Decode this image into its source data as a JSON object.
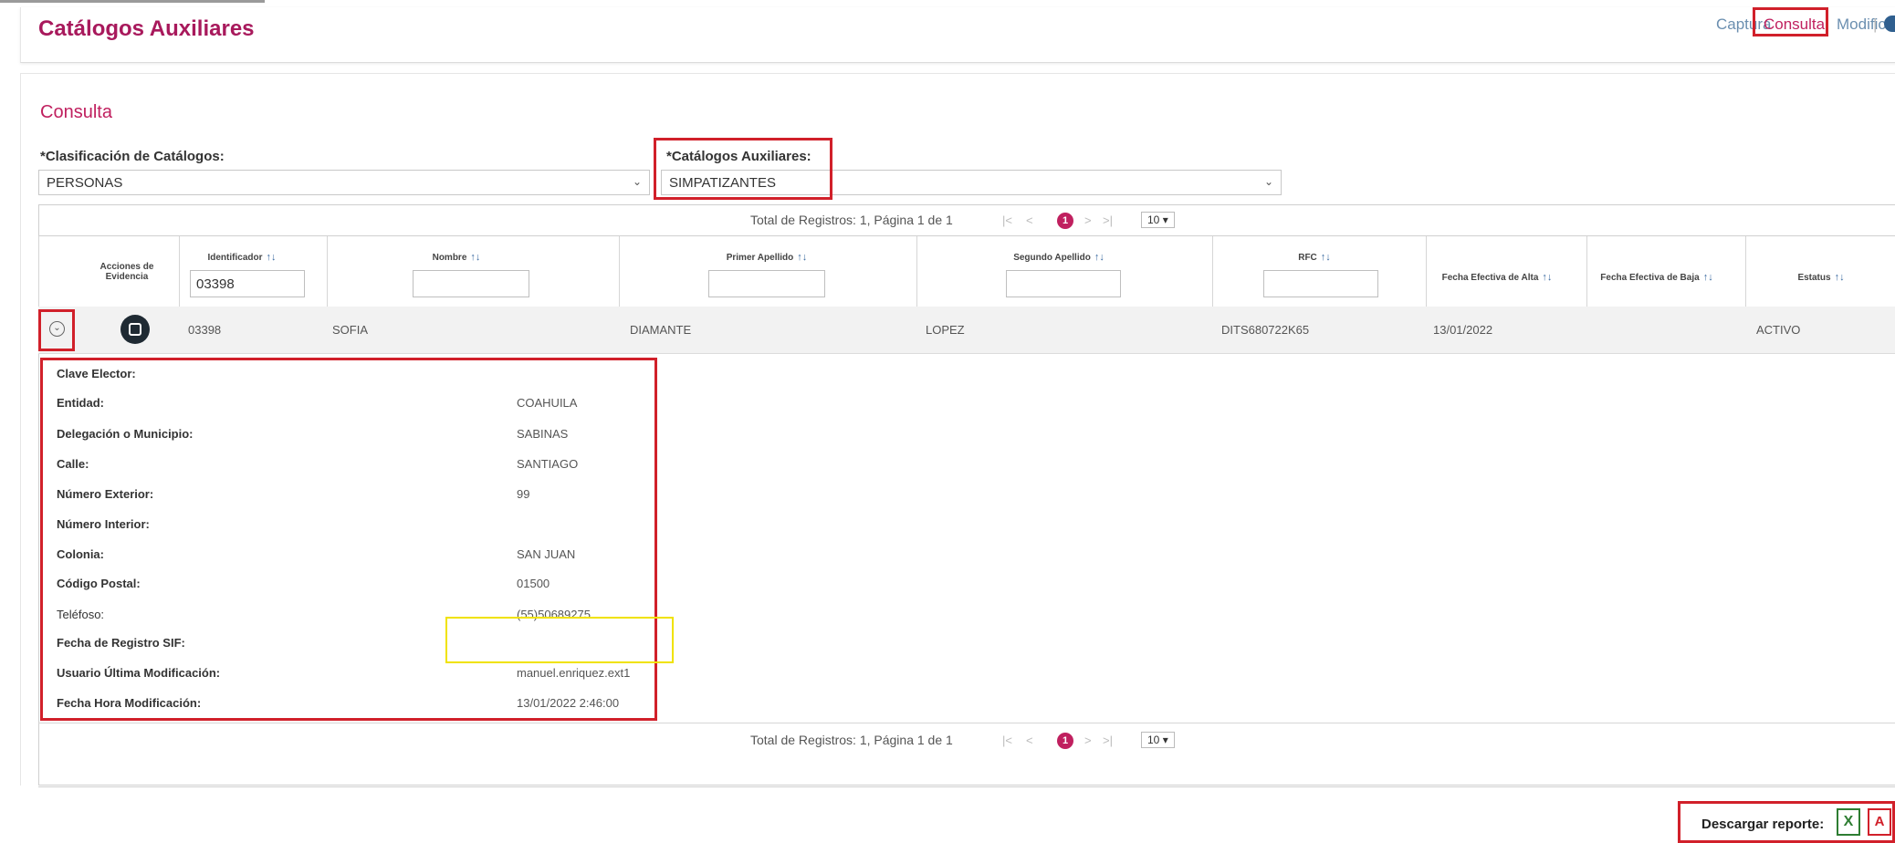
{
  "header": {
    "title": "Catálogos Auxiliares",
    "nav": {
      "captura": "Captura",
      "consulta": "Consulta",
      "modifica": "Modifica",
      "separator": "|"
    }
  },
  "section_title": "Consulta",
  "filters": {
    "clasificacion_label": "*Clasificación de Catálogos:",
    "clasificacion_value": "PERSONAS",
    "catalogos_label": "*Catálogos Auxiliares:",
    "catalogos_value": "SIMPATIZANTES"
  },
  "pager": {
    "summary": "Total de Registros: 1, Página 1 de 1",
    "current_page": "1",
    "page_size": "10"
  },
  "table": {
    "headers": {
      "acciones": "Acciones de Evidencia",
      "identificador": "Identificador",
      "nombre": "Nombre",
      "primer_apellido": "Primer Apellido",
      "segundo_apellido": "Segundo Apellido",
      "rfc": "RFC",
      "fecha_alta": "Fecha Efectiva de Alta",
      "fecha_baja": "Fecha Efectiva de Baja",
      "estatus": "Estatus"
    },
    "filter_identificador": "03398",
    "row": {
      "identificador": "03398",
      "nombre": "SOFIA",
      "primer_apellido": "DIAMANTE",
      "segundo_apellido": "LOPEZ",
      "rfc": "DITS680722K65",
      "fecha_alta": "13/01/2022",
      "fecha_baja": "",
      "estatus": "ACTIVO"
    }
  },
  "detail": {
    "clave_elector_label": "Clave Elector:",
    "clave_elector_value": "",
    "entidad_label": "Entidad:",
    "entidad_value": "COAHUILA",
    "delegacion_label": "Delegación o Municipio:",
    "delegacion_value": "SABINAS",
    "calle_label": "Calle:",
    "calle_value": "SANTIAGO",
    "num_ext_label": "Número Exterior:",
    "num_ext_value": "99",
    "num_int_label": "Número Interior:",
    "num_int_value": "",
    "colonia_label": "Colonia:",
    "colonia_value": "SAN JUAN",
    "cp_label": "Código Postal:",
    "cp_value": "01500",
    "telefono_label": "Teléfoso:",
    "telefono_value": "(55)50689275",
    "fecha_registro_label": "Fecha de Registro SIF:",
    "fecha_registro_value": "",
    "usuario_label": "Usuario Última Modificación:",
    "usuario_value": "manuel.enriquez.ext1",
    "fecha_hora_label": "Fecha Hora Modificación:",
    "fecha_hora_value": "13/01/2022 2:46:00"
  },
  "report": {
    "label": "Descargar reporte:",
    "xls_glyph": "X",
    "pdf_glyph": "A"
  },
  "icons": {
    "expand": "expand-circle-icon",
    "view": "view-evidence-icon",
    "sort": "sort-icon",
    "chevron": "chevron-down-icon",
    "help": "help-icon"
  },
  "colors": {
    "brand": "#a8195c",
    "accent": "#c0205f",
    "nav": "#6b8fb0",
    "highlight": "#d1202a"
  }
}
